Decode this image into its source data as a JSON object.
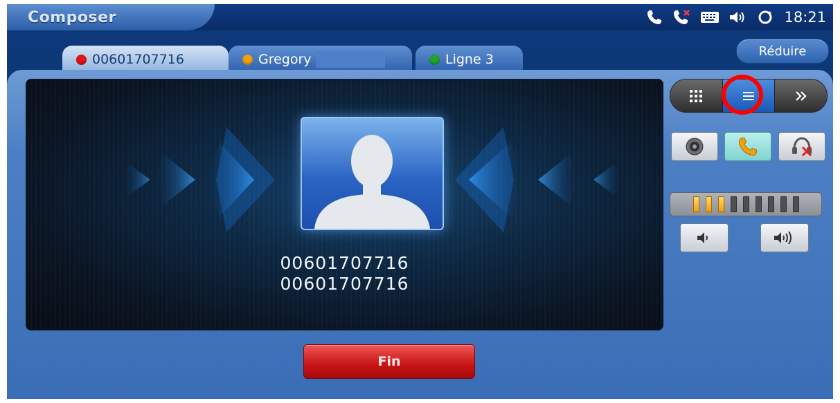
{
  "app": {
    "title": "Composer"
  },
  "status_bar": {
    "icons": [
      "phone-icon",
      "missed-call-icon",
      "keyboard-icon",
      "speaker-icon",
      "sync-icon"
    ],
    "time": "18:21"
  },
  "reduce_button": {
    "label": "Réduire"
  },
  "tabs": [
    {
      "label": "00601707716",
      "status_color": "#e01515",
      "active": true
    },
    {
      "label": "Gregory",
      "status_color": "#f3a30f",
      "active": false
    },
    {
      "label": "Ligne 3",
      "status_color": "#22a52a",
      "active": false
    }
  ],
  "caller": {
    "line1": "00601707716",
    "line2": "00601707716"
  },
  "end_call_button": {
    "label": "Fin"
  },
  "view_selector": {
    "options": [
      "keypad-icon",
      "list-icon",
      "forward-icon"
    ],
    "selected": "list-icon"
  },
  "call_controls": [
    "record-icon",
    "phone-icon",
    "headset-mute-icon"
  ],
  "volume": {
    "level": 3,
    "max": 9
  },
  "volume_controls": [
    "volume-down-icon",
    "volume-up-icon"
  ],
  "colors": {
    "accent": "#2d63ae",
    "end_call": "#d41919",
    "highlight": "#ff0000"
  }
}
